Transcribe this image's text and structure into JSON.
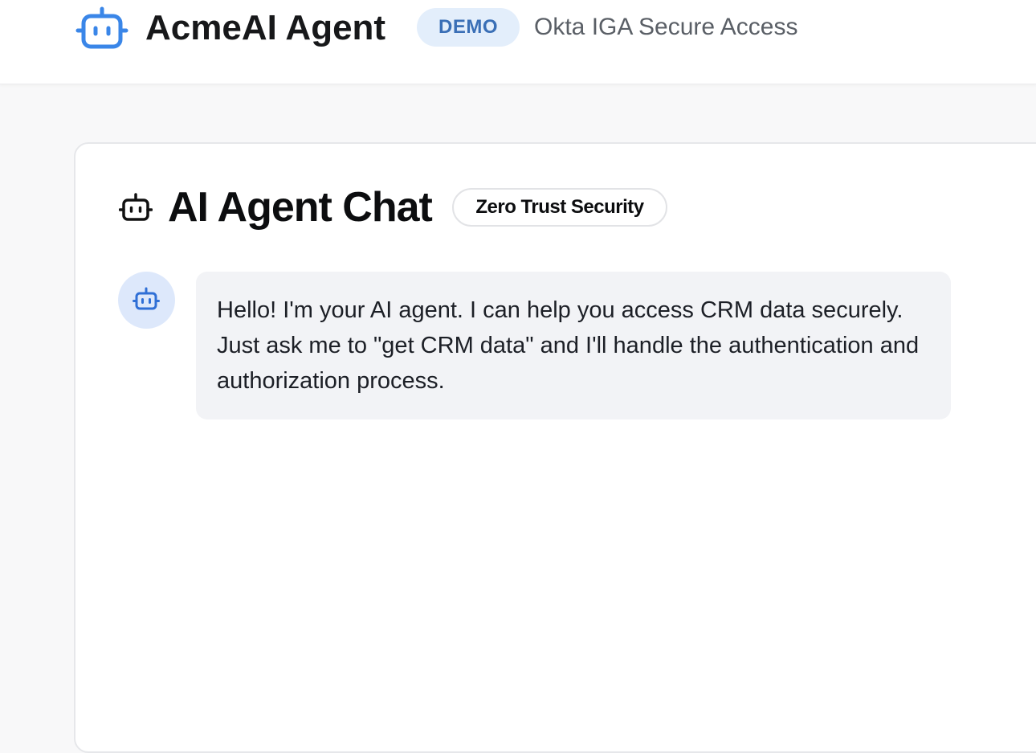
{
  "header": {
    "brand_icon": "robot-icon",
    "brand_name": "AcmeAI Agent",
    "badge": "DEMO",
    "subtitle": "Okta IGA Secure Access",
    "accent_color": "#3a86e8"
  },
  "chat": {
    "icon": "robot-icon",
    "title": "AI Agent Chat",
    "security_badge": "Zero Trust Security",
    "messages": [
      {
        "sender": "agent",
        "avatar_icon": "robot-icon",
        "text": "Hello! I'm your AI agent. I can help you access CRM data securely. Just ask me to \"get CRM data\" and I'll handle the authentication and authorization process."
      }
    ]
  }
}
